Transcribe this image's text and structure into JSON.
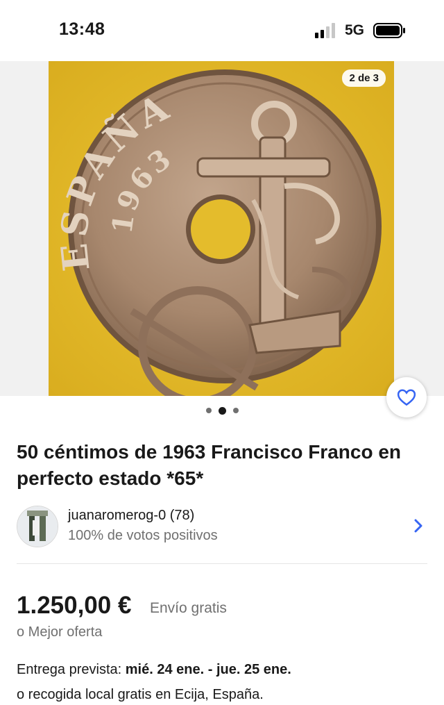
{
  "status_bar": {
    "time": "13:48",
    "network": "5G",
    "icons": [
      "signal-icon",
      "battery-icon"
    ]
  },
  "gallery": {
    "counter": "2 de 3",
    "pages": 3,
    "current_page": 2,
    "coin_text": {
      "country": "ESPAÑA",
      "year": "1963"
    }
  },
  "listing": {
    "title": "50 céntimos de 1963 Francisco Franco en perfecto estado *65*"
  },
  "seller": {
    "name": "juanaromerog-0 (78)",
    "feedback": "100% de votos positivos"
  },
  "pricing": {
    "price": "1.250,00 €",
    "shipping": "Envío gratis",
    "best_offer": "o Mejor oferta"
  },
  "delivery": {
    "label": "Entrega prevista:",
    "dates": "mié. 24 ene. - jue. 25 ene.",
    "pickup": "o recogida local gratis en Ecija, España."
  },
  "colors": {
    "accent_blue": "#3665f3",
    "text_primary": "#191919",
    "text_secondary": "#707070",
    "photo_background": "#e2b82a"
  }
}
